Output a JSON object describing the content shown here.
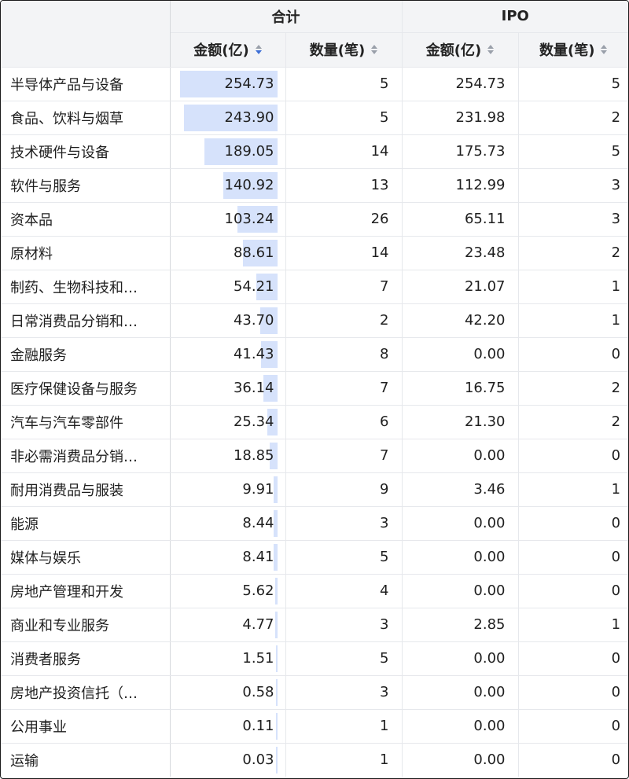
{
  "header": {
    "group_total": "合计",
    "group_ipo": "IPO",
    "col_amount": "金额(亿)",
    "col_count": "数量(笔)"
  },
  "sort": {
    "active_column": "total_amount",
    "direction": "descending"
  },
  "colors": {
    "bar": "#d6e2fb",
    "sort_active": "#3d6fd6",
    "sort_inactive": "#9aa0aa",
    "header_bg": "#f3f4f6"
  },
  "amount_bar_max": 254.73,
  "rows": [
    {
      "industry": "半导体产品与设备",
      "total_amount": "254.73",
      "total_count": "5",
      "ipo_amount": "254.73",
      "ipo_count": "5"
    },
    {
      "industry": "食品、饮料与烟草",
      "total_amount": "243.90",
      "total_count": "5",
      "ipo_amount": "231.98",
      "ipo_count": "2"
    },
    {
      "industry": "技术硬件与设备",
      "total_amount": "189.05",
      "total_count": "14",
      "ipo_amount": "175.73",
      "ipo_count": "5"
    },
    {
      "industry": "软件与服务",
      "total_amount": "140.92",
      "total_count": "13",
      "ipo_amount": "112.99",
      "ipo_count": "3"
    },
    {
      "industry": "资本品",
      "total_amount": "103.24",
      "total_count": "26",
      "ipo_amount": "65.11",
      "ipo_count": "3"
    },
    {
      "industry": "原材料",
      "total_amount": "88.61",
      "total_count": "14",
      "ipo_amount": "23.48",
      "ipo_count": "2"
    },
    {
      "industry": "制药、生物科技和…",
      "total_amount": "54.21",
      "total_count": "7",
      "ipo_amount": "21.07",
      "ipo_count": "1"
    },
    {
      "industry": "日常消费品分销和…",
      "total_amount": "43.70",
      "total_count": "2",
      "ipo_amount": "42.20",
      "ipo_count": "1"
    },
    {
      "industry": "金融服务",
      "total_amount": "41.43",
      "total_count": "8",
      "ipo_amount": "0.00",
      "ipo_count": "0"
    },
    {
      "industry": "医疗保健设备与服务",
      "total_amount": "36.14",
      "total_count": "7",
      "ipo_amount": "16.75",
      "ipo_count": "2"
    },
    {
      "industry": "汽车与汽车零部件",
      "total_amount": "25.34",
      "total_count": "6",
      "ipo_amount": "21.30",
      "ipo_count": "2"
    },
    {
      "industry": "非必需消费品分销…",
      "total_amount": "18.85",
      "total_count": "7",
      "ipo_amount": "0.00",
      "ipo_count": "0"
    },
    {
      "industry": "耐用消费品与服装",
      "total_amount": "9.91",
      "total_count": "9",
      "ipo_amount": "3.46",
      "ipo_count": "1"
    },
    {
      "industry": "能源",
      "total_amount": "8.44",
      "total_count": "3",
      "ipo_amount": "0.00",
      "ipo_count": "0"
    },
    {
      "industry": "媒体与娱乐",
      "total_amount": "8.41",
      "total_count": "5",
      "ipo_amount": "0.00",
      "ipo_count": "0"
    },
    {
      "industry": "房地产管理和开发",
      "total_amount": "5.62",
      "total_count": "4",
      "ipo_amount": "0.00",
      "ipo_count": "0"
    },
    {
      "industry": "商业和专业服务",
      "total_amount": "4.77",
      "total_count": "3",
      "ipo_amount": "2.85",
      "ipo_count": "1"
    },
    {
      "industry": "消费者服务",
      "total_amount": "1.51",
      "total_count": "5",
      "ipo_amount": "0.00",
      "ipo_count": "0"
    },
    {
      "industry": "房地产投资信托（…",
      "total_amount": "0.58",
      "total_count": "3",
      "ipo_amount": "0.00",
      "ipo_count": "0"
    },
    {
      "industry": "公用事业",
      "total_amount": "0.11",
      "total_count": "1",
      "ipo_amount": "0.00",
      "ipo_count": "0"
    },
    {
      "industry": "运输",
      "total_amount": "0.03",
      "total_count": "1",
      "ipo_amount": "0.00",
      "ipo_count": "0"
    }
  ]
}
